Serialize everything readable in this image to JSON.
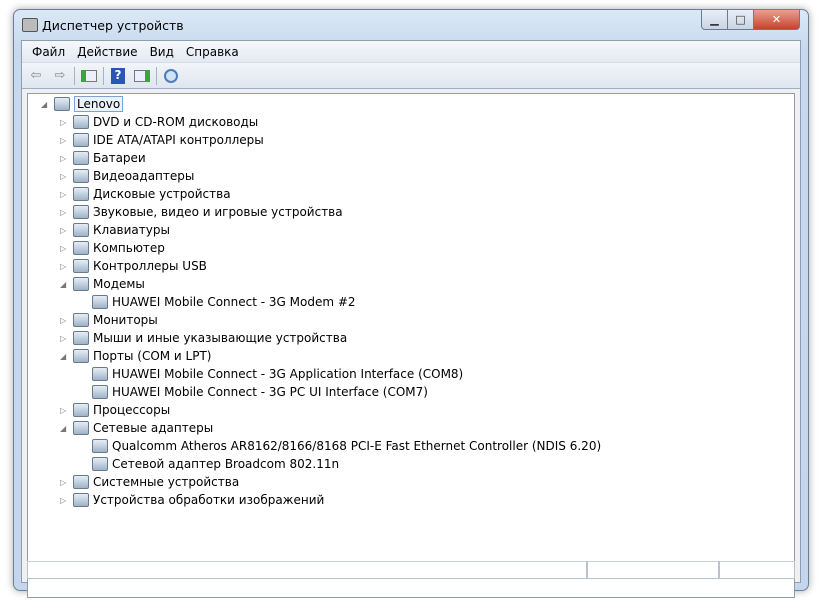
{
  "window": {
    "title": "Диспетчер устройств"
  },
  "menu": [
    "Файл",
    "Действие",
    "Вид",
    "Справка"
  ],
  "toolbar": [
    "back-icon",
    "forward-icon",
    "show-hide-console-tree-icon",
    "help-icon",
    "properties-icon",
    "scan-hardware-icon"
  ],
  "tree": {
    "root": "Lenovo",
    "items": [
      {
        "label": "DVD и CD-ROM дисководы",
        "expanded": false
      },
      {
        "label": "IDE ATA/ATAPI контроллеры",
        "expanded": false
      },
      {
        "label": "Батареи",
        "expanded": false
      },
      {
        "label": "Видеоадаптеры",
        "expanded": false
      },
      {
        "label": "Дисковые устройства",
        "expanded": false
      },
      {
        "label": "Звуковые, видео и игровые устройства",
        "expanded": false
      },
      {
        "label": "Клавиатуры",
        "expanded": false
      },
      {
        "label": "Компьютер",
        "expanded": false
      },
      {
        "label": "Контроллеры USB",
        "expanded": false
      },
      {
        "label": "Модемы",
        "expanded": true,
        "children": [
          "HUAWEI Mobile Connect - 3G Modem #2"
        ]
      },
      {
        "label": "Мониторы",
        "expanded": false
      },
      {
        "label": "Мыши и иные указывающие устройства",
        "expanded": false
      },
      {
        "label": "Порты (COM и LPT)",
        "expanded": true,
        "children": [
          "HUAWEI Mobile Connect - 3G Application Interface (COM8)",
          "HUAWEI Mobile Connect - 3G PC UI Interface (COM7)"
        ]
      },
      {
        "label": "Процессоры",
        "expanded": false
      },
      {
        "label": "Сетевые адаптеры",
        "expanded": true,
        "children": [
          "Qualcomm Atheros AR8162/8166/8168 PCI-E Fast Ethernet Controller (NDIS 6.20)",
          "Сетевой адаптер Broadcom 802.11n"
        ]
      },
      {
        "label": "Системные устройства",
        "expanded": false
      },
      {
        "label": "Устройства обработки изображений",
        "expanded": false
      }
    ]
  }
}
